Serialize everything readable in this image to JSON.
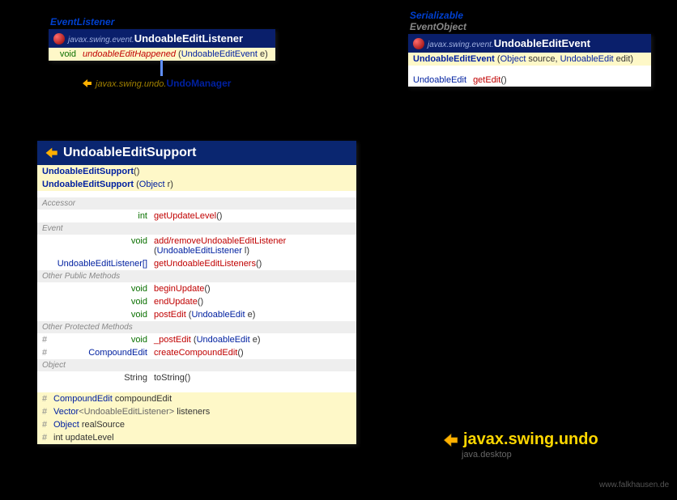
{
  "listener": {
    "supertype": "EventListener",
    "package": "javax.swing.event.",
    "name": "UndoableEditListener",
    "methods": [
      {
        "ret": "void",
        "name": "undoableEditHappened",
        "params": "(UndoableEditEvent e)"
      }
    ],
    "impl_package": "javax.swing.undo.",
    "impl_name": "UndoManager"
  },
  "event": {
    "supertype1": "Serializable",
    "supertype2": "EventObject",
    "package": "javax.swing.event.",
    "name": "UndoableEditEvent",
    "ctor": {
      "name": "UndoableEditEvent",
      "params_pre": "(",
      "ptype1": "Object",
      "pname1": " source, ",
      "ptype2": "UndoableEdit",
      "pname2": " edit)"
    },
    "methods": [
      {
        "ret": "UndoableEdit",
        "name": "getEdit",
        "params": "()"
      }
    ]
  },
  "support": {
    "name": "UndoableEditSupport",
    "ctors": [
      {
        "name": "UndoableEditSupport",
        "params": "()"
      },
      {
        "name": "UndoableEditSupport",
        "params_pre": "(",
        "ptype": "Object",
        "pname": " r)"
      }
    ],
    "sections": {
      "accessor": "Accessor",
      "event": "Event",
      "otherPublic": "Other Public Methods",
      "otherProtected": "Other Protected Methods",
      "object": "Object"
    },
    "accessor": [
      {
        "ret": "int",
        "name": "getUpdateLevel",
        "params": "()"
      }
    ],
    "eventMethods": [
      {
        "ret": "void",
        "name": "add/removeUndoableEditListener",
        "params_pre": "(",
        "ptype": "UndoableEditListener",
        "pname": " l)"
      },
      {
        "ret_type": "UndoableEditListener[]",
        "name": "getUndoableEditListeners",
        "params": "()"
      }
    ],
    "publicMethods": [
      {
        "ret": "void",
        "name": "beginUpdate",
        "params": "()"
      },
      {
        "ret": "void",
        "name": "endUpdate",
        "params": "()"
      },
      {
        "ret": "void",
        "name": "postEdit",
        "params_pre": "(",
        "ptype": "UndoableEdit",
        "pname": " e)"
      }
    ],
    "protectedMethods": [
      {
        "hash": "#",
        "ret": "void",
        "name": "_postEdit",
        "params_pre": "(",
        "ptype": "UndoableEdit",
        "pname": " e)"
      },
      {
        "hash": "#",
        "ret_type": "CompoundEdit",
        "name": "createCompoundEdit",
        "params": "()"
      }
    ],
    "objectMethods": [
      {
        "ret_type_plain": "String",
        "name": "toString",
        "params": "()"
      }
    ],
    "fields": [
      {
        "hash": "#",
        "type": "CompoundEdit",
        "name": " compoundEdit"
      },
      {
        "hash": "#",
        "type_pre": "Vector",
        "type_gen": "<UndoableEditListener>",
        "name": " listeners"
      },
      {
        "hash": "#",
        "type": "Object",
        "name": " realSource"
      },
      {
        "hash": "#",
        "type_plain": "int",
        "name": " updateLevel"
      }
    ]
  },
  "footer": {
    "package": "javax.swing.undo",
    "module": "java.desktop",
    "site": "www.falkhausen.de"
  }
}
